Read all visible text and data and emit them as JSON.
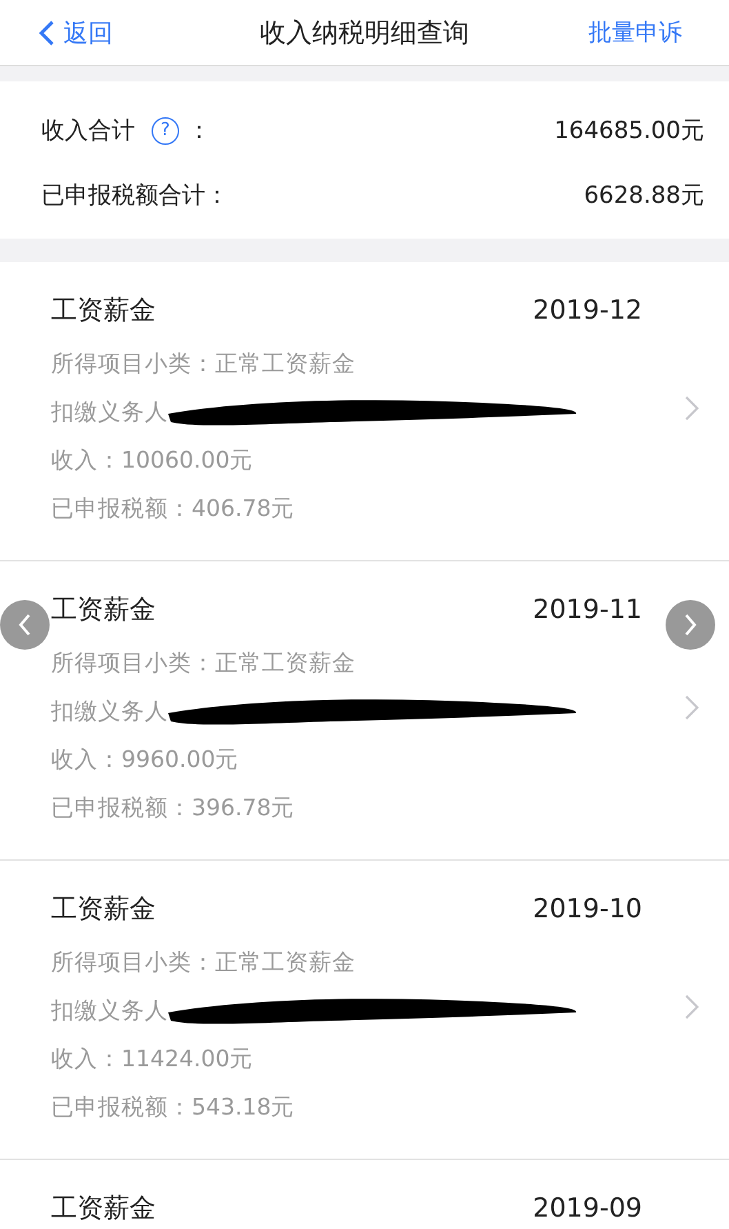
{
  "nav": {
    "back": "返回",
    "title": "收入纳税明细查询",
    "action": "批量申诉"
  },
  "summary": [
    {
      "label": "收入合计",
      "help": "?",
      "suffix": "：",
      "value": "164685.00元"
    },
    {
      "label": "已申报税额合计：",
      "value": "6628.88元"
    }
  ],
  "records": [
    {
      "title": "工资薪金",
      "period": "2019-12",
      "subcategory": "所得项目小类：正常工资薪金",
      "withholder": "扣缴义务人",
      "redacted": true,
      "income": "收入：10060.00元",
      "tax": "已申报税额：406.78元"
    },
    {
      "title": "工资薪金",
      "period": "2019-11",
      "subcategory": "所得项目小类：正常工资薪金",
      "withholder": "扣缴义务人",
      "redacted": true,
      "income": "收入：9960.00元",
      "tax": "已申报税额：396.78元"
    },
    {
      "title": "工资薪金",
      "period": "2019-10",
      "subcategory": "所得项目小类：正常工资薪金",
      "withholder": "扣缴义务人",
      "redacted": true,
      "income": "收入：11424.00元",
      "tax": "已申报税额：543.18元"
    },
    {
      "title": "工资薪金",
      "period": "2019-09"
    }
  ]
}
